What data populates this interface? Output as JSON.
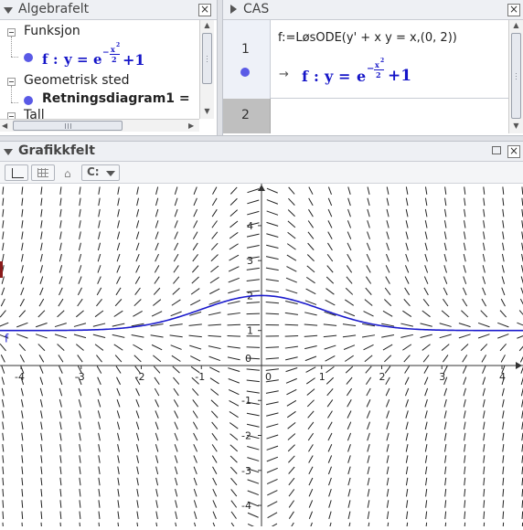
{
  "algebra": {
    "title": "Algebrafelt",
    "groups": [
      {
        "label": "Funksjon"
      },
      {
        "label": "Geometrisk sted"
      },
      {
        "label": "Tall"
      }
    ],
    "func_name": "f",
    "func_sep": ":",
    "func_y": "y",
    "func_eq": "=",
    "func_base": "e",
    "func_exp_sign": "−",
    "func_exp_num": "x",
    "func_exp_pow": "2",
    "func_exp_den": "2",
    "func_tail": "+1",
    "locus_label": "Retningsdiagram1 ="
  },
  "cas": {
    "title": "CAS",
    "rows": [
      {
        "number": "1",
        "input": "f:=LøsODE(y' + x y = x,(0, 2))",
        "arrow": "→",
        "out_name": "f",
        "out_sep": ":",
        "out_y": "y",
        "out_eq": "=",
        "out_base": "e",
        "out_exp_sign": "−",
        "out_exp_num": "x",
        "out_exp_pow": "2",
        "out_exp_den": "2",
        "out_tail": "+1"
      },
      {
        "number": "2"
      }
    ]
  },
  "graphics": {
    "title": "Grafikkfelt",
    "curve_label": "f",
    "toolbar_menu_glyph": "C:",
    "x_ticks": [
      "-4",
      "-3",
      "-2",
      "-1",
      "0",
      "1",
      "2",
      "3",
      "4"
    ],
    "y_ticks": [
      "4",
      "3",
      "2",
      "1",
      "0",
      "-1",
      "-2",
      "-3",
      "-4"
    ]
  },
  "chart_data": {
    "type": "line",
    "title": "",
    "xlabel": "",
    "ylabel": "",
    "xlim": [
      -4.35,
      4.35
    ],
    "ylim": [
      -4.6,
      5.2
    ],
    "grid": false,
    "series": [
      {
        "name": "f",
        "function": "y = e^(-x^2/2) + 1",
        "color": "#1a1acc",
        "x": [
          -4,
          -3,
          -2,
          -1.5,
          -1,
          -0.5,
          0,
          0.5,
          1,
          1.5,
          2,
          3,
          4
        ],
        "values": [
          1.0003,
          1.011,
          1.135,
          1.325,
          1.607,
          1.882,
          2.0,
          1.882,
          1.607,
          1.325,
          1.135,
          1.011,
          1.0003
        ]
      }
    ],
    "slope_field": {
      "ode": "y' = x - x*y",
      "color": "#222222"
    }
  }
}
